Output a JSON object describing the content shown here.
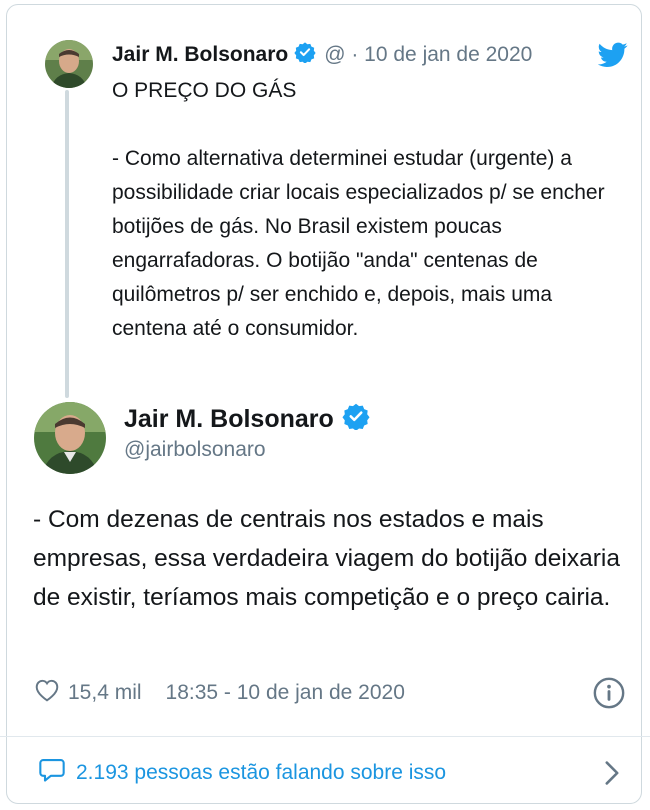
{
  "parent_tweet": {
    "author_name": "Jair M. Bolsonaro",
    "meta": "@ · 10 de jan de 2020",
    "text": "O PREÇO DO GÁS\n\n- Como alternativa determinei estudar (urgente) a possibilidade criar locais especializados p/ se encher botijões de gás. No Brasil existem poucas engarrafadoras. O botijão \"anda\" centenas de quilômetros p/ ser enchido e, depois, mais uma centena até o consumidor."
  },
  "main_tweet": {
    "author_name": "Jair M. Bolsonaro",
    "handle": "@jairbolsonaro",
    "text": "- Com dezenas de centrais nos estados e mais empresas, essa verdadeira viagem do botijão deixaria de existir, teríamos mais competição e o preço cairia.",
    "likes": "15,4 mil",
    "timestamp": "18:35 - 10 de jan de 2020"
  },
  "conversation": {
    "label": "2.193 pessoas estão falando sobre isso"
  },
  "colors": {
    "accent": "#1da1f2",
    "link": "#1b95e0",
    "muted": "#657786",
    "text": "#14171a"
  },
  "icons": {
    "verified": "verified-badge-icon",
    "bird": "twitter-bird-icon",
    "like": "heart-icon",
    "info": "info-icon",
    "reply": "speech-bubble-icon",
    "chevron": "chevron-right-icon"
  }
}
